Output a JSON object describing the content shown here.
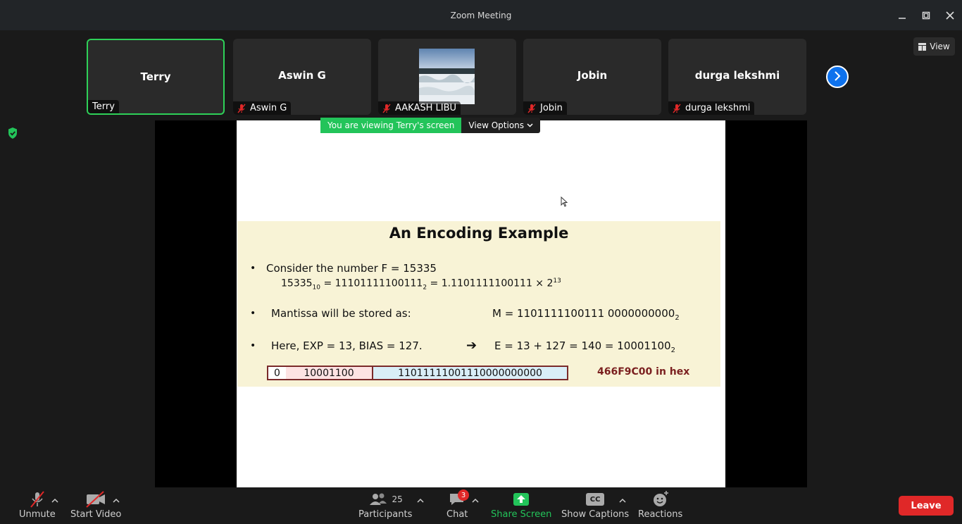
{
  "window": {
    "title": "Zoom Meeting"
  },
  "colors": {
    "active_speaker": "#2ed158",
    "share_banner": "#23c45a",
    "leave": "#e02828",
    "accent_blue": "#0e72ed"
  },
  "gallery": {
    "tiles": [
      {
        "center_name": "Terry",
        "tag": "Terry",
        "muted": false,
        "active": true,
        "has_video": false
      },
      {
        "center_name": "Aswin G",
        "tag": "Aswin G",
        "muted": true,
        "active": false,
        "has_video": false
      },
      {
        "center_name": "",
        "tag": "AAKASH LIBU",
        "muted": true,
        "active": false,
        "has_video": true
      },
      {
        "center_name": "Jobin",
        "tag": "Jobin",
        "muted": true,
        "active": false,
        "has_video": false
      },
      {
        "center_name": "durga lekshmi",
        "tag": "durga lekshmi",
        "muted": true,
        "active": false,
        "has_video": false
      }
    ],
    "view_label": "View"
  },
  "share": {
    "banner": "You are viewing Terry's screen",
    "options_label": "View Options"
  },
  "slide": {
    "title": "An Encoding Example",
    "line1": "Consider the number F = 15335",
    "line2_a": "15335",
    "line2_a_sub": "10",
    "line2_b": " = 11101111100111",
    "line2_b_sub": "2",
    "line2_c": " = 1.1101111100111 × 2",
    "line2_c_sup": "13",
    "line3_a": "Mantissa will be stored as:",
    "line3_b": "M = 1101111100111 0000000000",
    "line3_b_sub": "2",
    "line4_a": "Here, EXP = 13,  BIAS = 127.",
    "line4_arrow": "➔",
    "line4_b": "E = 13 + 127 = 140  =  10001100",
    "line4_b_sub": "2",
    "bits_sign": "0",
    "bits_exp": "10001100",
    "bits_mantissa": "11011111001110000000000",
    "hex": "466F9C00 in hex"
  },
  "toolbar": {
    "unmute": "Unmute",
    "start_video": "Start Video",
    "participants": "Participants",
    "participants_count": "25",
    "chat": "Chat",
    "chat_badge": "3",
    "share_screen": "Share Screen",
    "captions": "Show Captions",
    "captions_icon_text": "CC",
    "reactions": "Reactions",
    "leave": "Leave"
  }
}
